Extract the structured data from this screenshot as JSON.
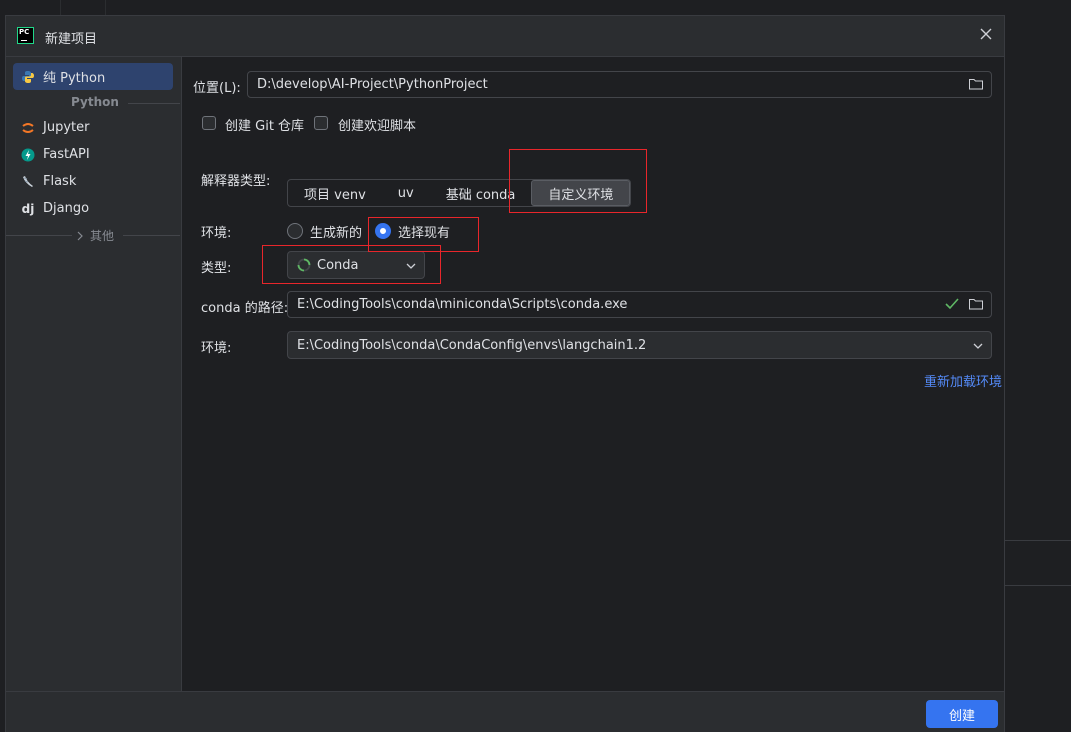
{
  "dialog": {
    "title": "新建项目",
    "close_icon": "close-icon"
  },
  "sidebar": {
    "items": [
      {
        "label": "纯 Python",
        "icon": "python-icon",
        "selected": true
      },
      {
        "label": "Jupyter",
        "icon": "jupyter-icon"
      },
      {
        "label": "FastAPI",
        "icon": "fastapi-icon"
      },
      {
        "label": "Flask",
        "icon": "flask-icon"
      },
      {
        "label": "Django",
        "icon": "django-icon"
      }
    ],
    "group_label": "Python",
    "more_label": "其他"
  },
  "form": {
    "location_label": "位置(L):",
    "location_value": "D:\\develop\\AI-Project\\PythonProject",
    "git_checkbox_label": "创建 Git 仓库",
    "welcome_checkbox_label": "创建欢迎脚本",
    "interpreter_type_label": "解释器类型:",
    "interpreter_types": [
      "项目 venv",
      "uv",
      "基础 conda",
      "自定义环境"
    ],
    "interpreter_type_selected": "自定义环境",
    "env_label": "环境:",
    "env_option_new": "生成新的",
    "env_option_existing": "选择现有",
    "type_label": "类型:",
    "type_value": "Conda",
    "conda_path_label": "conda 的路径:",
    "conda_path_value": "E:\\CodingTools\\conda\\miniconda\\Scripts\\conda.exe",
    "env_path_label": "环境:",
    "env_path_value": "E:\\CodingTools\\conda\\CondaConfig\\envs\\langchain1.2",
    "reload_link": "重新加载环境"
  },
  "footer": {
    "create_button": "创建"
  },
  "colors": {
    "accent": "#3574f0",
    "link": "#548af7",
    "annotation": "#e8262b",
    "check": "#5fb865"
  }
}
